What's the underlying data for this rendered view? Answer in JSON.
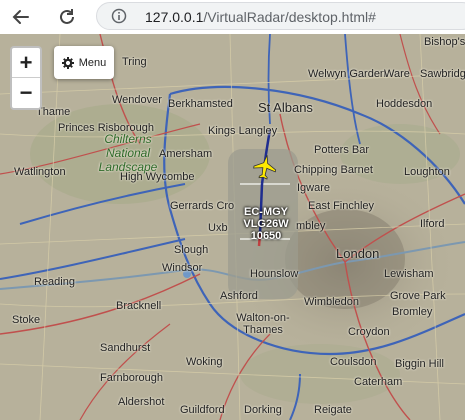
{
  "browser": {
    "url_host": "127.0.0.1",
    "url_path": "/VirtualRadar/desktop.html#"
  },
  "map": {
    "zoom_in_label": "+",
    "zoom_out_label": "−",
    "menu_label": "Menu",
    "places": {
      "bishops": "Bishop's",
      "tring": "Tring",
      "welwyn": "Welwyn Garden",
      "ware": "Ware",
      "sawbridg": "Sawbridg",
      "wendover": "Wendover",
      "berkhamsted": "Berkhamsted",
      "st_albans": "St Albans",
      "hoddesdon": "Hoddesdon",
      "thame": "Thame",
      "princes_risborough": "Princes Risborough",
      "kings_langley": "Kings Langley",
      "potters_bar": "Potters Bar",
      "chilterns": "Chilterns National Landscape",
      "amersham": "Amersham",
      "chipping_barnet": "Chipping Barnet",
      "watlington": "Watlington",
      "high_wycombe": "High Wycombe",
      "edgware": "Igware",
      "loughton": "Loughton",
      "gerrards_cross": "Gerrards Cro",
      "east_finchley": "East Finchley",
      "uxbridge": "Uxb",
      "wembley": "mbley",
      "ilford": "Ilford",
      "slough": "Slough",
      "london": "London",
      "windsor": "Windsor",
      "reading": "Reading",
      "hounslow": "Hounslow",
      "lewisham": "Lewisham",
      "bracknell": "Bracknell",
      "ashford": "Ashford",
      "wimbledon": "Wimbledon",
      "grove_park": "Grove Park",
      "walton": "Walton-on-Thames",
      "bromley": "Bromley",
      "croydon": "Croydon",
      "sandhurst": "Sandhurst",
      "woking": "Woking",
      "coulsdon": "Coulsdon",
      "biggin_hill": "Biggin Hill",
      "farnborough": "Farnborough",
      "caterham": "Caterham",
      "aldershot": "Aldershot",
      "guildford": "Guildford",
      "dorking": "Dorking",
      "reigate": "Reigate",
      "stoke": "Stoke"
    }
  },
  "aircraft": {
    "registration": "EC-MGY",
    "callsign": "VLG26W",
    "altitude": "10650"
  }
}
